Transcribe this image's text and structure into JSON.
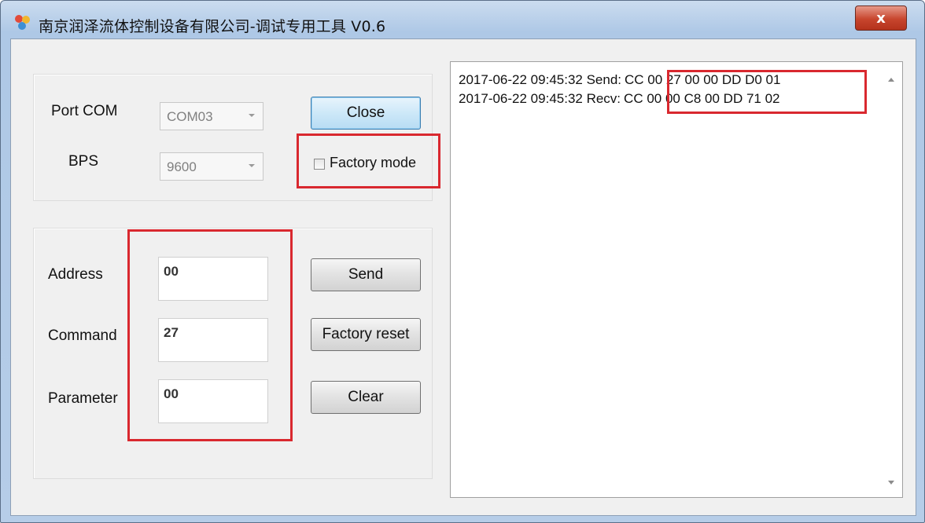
{
  "window": {
    "title": "南京润泽流体控制设备有限公司-调试专用工具 V0.6",
    "close_glyph": "x"
  },
  "connection": {
    "port_label": "Port COM",
    "port_value": "COM03",
    "bps_label": "BPS",
    "bps_value": "9600",
    "close_button": "Close",
    "factory_mode_label": "Factory mode",
    "factory_mode_checked": false
  },
  "command_panel": {
    "address_label": "Address",
    "address_value": "00",
    "command_label": "Command",
    "command_value": "27",
    "parameter_label": "Parameter",
    "parameter_value": "00",
    "send_button": "Send",
    "factory_reset_button": "Factory reset",
    "clear_button": "Clear"
  },
  "log": {
    "lines": [
      {
        "prefix": "2017-06-22 09:45:32 Send:",
        "hex": "CC 00 27 00 00 DD D0 01"
      },
      {
        "prefix": "2017-06-22 09:45:32 Recv:",
        "hex": "CC 00 00 C8 00 DD 71 02"
      }
    ]
  },
  "colors": {
    "highlight_red": "#d9282f",
    "focus_blue": "#3c7fb1"
  }
}
